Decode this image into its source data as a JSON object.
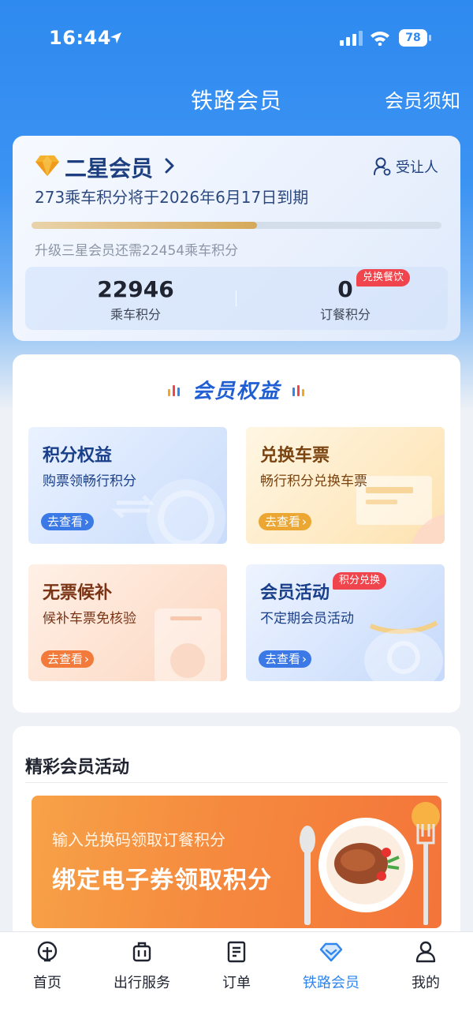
{
  "status_bar": {
    "time": "16:44",
    "battery": "78"
  },
  "nav": {
    "title": "铁路会员",
    "right_action": "会员须知"
  },
  "member_card": {
    "level": "二星会员",
    "beneficiary_label": "受让人",
    "expiry_notice": "273乘车积分将于2026年6月17日到期",
    "progress_fraction": 0.55,
    "upgrade_notice": "升级三星会员还需22454乘车积分",
    "ride_points_value": "22946",
    "ride_points_label": "乘车积分",
    "meal_points_value": "0",
    "meal_points_label": "订餐积分",
    "meal_badge": "兑换餐饮"
  },
  "benefits": {
    "title": "会员权益",
    "tiles": [
      {
        "title": "积分权益",
        "subtitle": "购票领畅行积分",
        "button": "去查看",
        "badge": ""
      },
      {
        "title": "兑换车票",
        "subtitle": "畅行积分兑换车票",
        "button": "去查看",
        "badge": ""
      },
      {
        "title": "无票候补",
        "subtitle": "候补车票免核验",
        "button": "去查看",
        "badge": ""
      },
      {
        "title": "会员活动",
        "subtitle": "不定期会员活动",
        "button": "去查看",
        "badge": "积分兑换"
      }
    ]
  },
  "activities": {
    "title": "精彩会员活动",
    "banner_subtitle": "输入兑换码领取订餐积分",
    "banner_title": "绑定电子券领取积分"
  },
  "tab_bar": {
    "tabs": [
      {
        "label": "首页",
        "icon": "rail-logo-icon",
        "active": false
      },
      {
        "label": "出行服务",
        "icon": "luggage-icon",
        "active": false
      },
      {
        "label": "订单",
        "icon": "order-list-icon",
        "active": false
      },
      {
        "label": "铁路会员",
        "icon": "diamond-icon",
        "active": true
      },
      {
        "label": "我的",
        "icon": "person-icon",
        "active": false
      }
    ]
  },
  "colors": {
    "primary": "#2f86ef",
    "badge_red": "#f0454c",
    "gold": "#d6a95a"
  }
}
